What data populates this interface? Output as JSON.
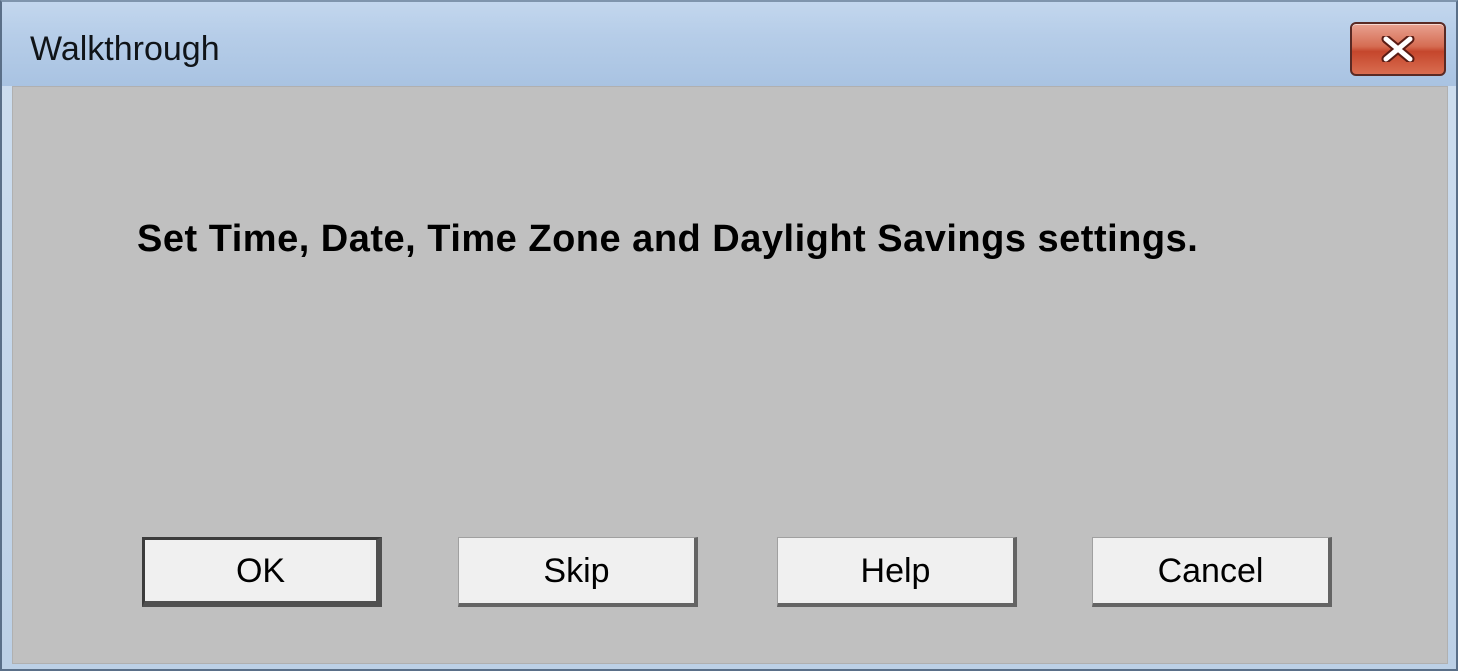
{
  "window": {
    "title": "Walkthrough",
    "close_icon": "close-icon"
  },
  "dialog": {
    "message": "Set Time, Date, Time Zone and Daylight Savings settings."
  },
  "buttons": {
    "ok": "OK",
    "skip": "Skip",
    "help": "Help",
    "cancel": "Cancel"
  },
  "colors": {
    "client_bg": "#c0c0c0",
    "close_button": "#c5462c"
  }
}
